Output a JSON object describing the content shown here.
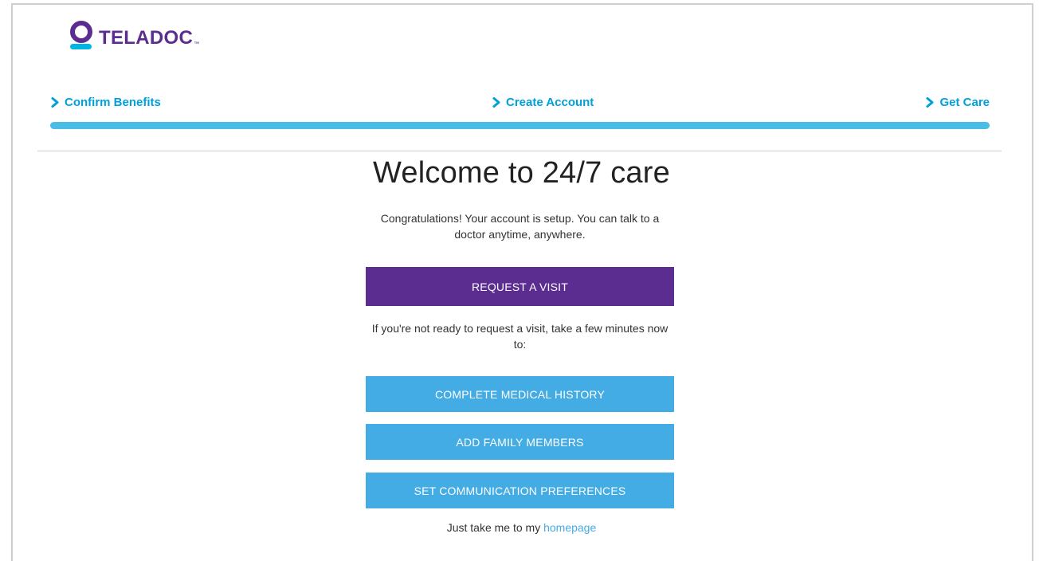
{
  "brand": {
    "name": "TELADOC",
    "trademark": "™",
    "primary_color": "#5c2d91",
    "accent_color": "#00b5e2"
  },
  "steps": [
    {
      "label": "Confirm Benefits",
      "icon": "chevron-right-icon"
    },
    {
      "label": "Create Account",
      "icon": "chevron-right-icon"
    },
    {
      "label": "Get Care",
      "icon": "chevron-right-icon"
    }
  ],
  "progress": {
    "complete_fraction": 1.0,
    "color": "#49bde5"
  },
  "main": {
    "title": "Welcome to 24/7 care",
    "subtitle": "Congratulations! Your account is setup. You can talk to a doctor anytime, anywhere.",
    "primary_button": "REQUEST A VISIT",
    "prompt": "If you're not ready to request a visit, take a few minutes now to:",
    "secondary_buttons": [
      "COMPLETE MEDICAL HISTORY",
      "ADD FAMILY MEMBERS",
      "SET COMMUNICATION PREFERENCES"
    ],
    "footer_text": "Just take me to my",
    "footer_link": "homepage"
  },
  "colors": {
    "request_button": "#5c2d91",
    "secondary_button": "#43ace5",
    "step_link": "#00a0dc"
  }
}
